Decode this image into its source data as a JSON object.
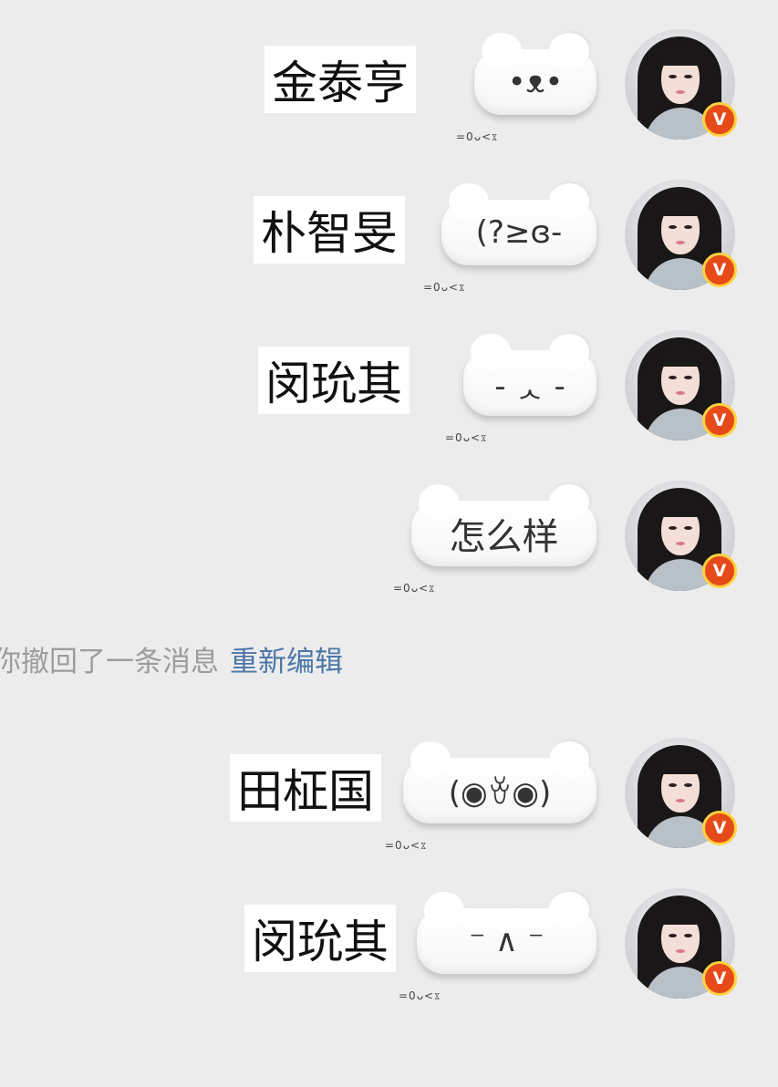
{
  "messages": [
    {
      "name": "金泰亨",
      "sticker": "•ᴥ•",
      "caption": "=0ᴗ<ೱ"
    },
    {
      "name": "朴智旻",
      "sticker": "(?≥ɞ-",
      "caption": "=0ᴗ<ೱ"
    },
    {
      "name": "闵玧其",
      "sticker": "- ᆺ -",
      "caption": "=0ᴗ<ೱ"
    },
    {
      "name": "",
      "sticker": "怎么样",
      "caption": "=0ᴗ<ೱ"
    },
    {
      "name": "田柾国",
      "sticker": "(◉ꈊ◉)",
      "caption": "=0ᴗ<ೱ"
    },
    {
      "name": "闵玧其",
      "sticker": "⁻ ∧ ⁻",
      "caption": "=0ᴗ<ೱ"
    }
  ],
  "recall_notice": {
    "text": "你撤回了一条消息",
    "action": "重新编辑"
  },
  "avatar": {
    "badge": "V",
    "badge_color": "#e64a19",
    "badge_ring": "#ffd23f"
  }
}
